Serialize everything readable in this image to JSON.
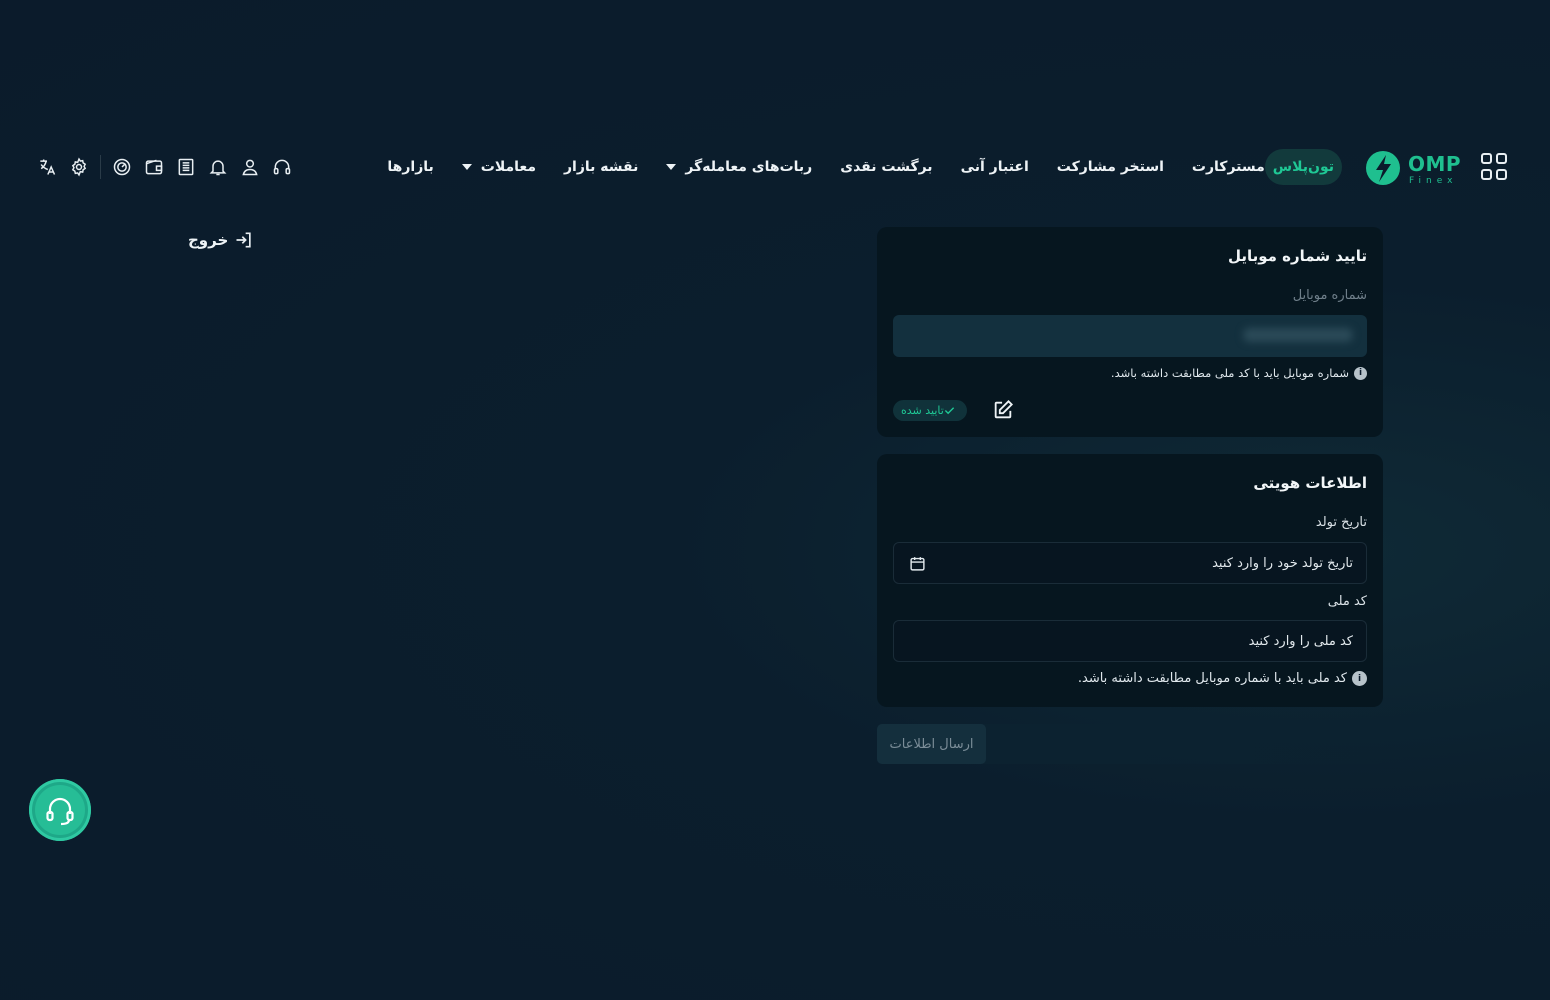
{
  "header": {
    "logo": {
      "word": "OMP",
      "sub": "Finex"
    },
    "nav": [
      {
        "label": "بازارها",
        "caret": false
      },
      {
        "label": "معاملات",
        "caret": true
      },
      {
        "label": "نقشه بازار",
        "caret": false
      },
      {
        "label": "ربات‌های معامله‌گر",
        "caret": true
      },
      {
        "label": "برگشت نقدی",
        "caret": false
      },
      {
        "label": "اعتبار آنی",
        "caret": false
      },
      {
        "label": "استخر مشارکت",
        "caret": false
      },
      {
        "label": "مسترکارت",
        "caret": false
      },
      {
        "label": "تون‌پلاس",
        "caret": false,
        "highlight": true
      }
    ],
    "toolbar_icons": [
      "headset-icon",
      "user-icon",
      "bell-icon",
      "orders-icon",
      "wallet-icon",
      "gauge-icon",
      "settings-icon",
      "language-icon"
    ]
  },
  "logout": {
    "label": "خروج"
  },
  "mobile_card": {
    "title": "تایید شماره موبایل",
    "field_label": "شماره موبایل",
    "hint": "شماره موبایل باید با کد ملی مطابقت داشته باشد.",
    "status": "تایید شده"
  },
  "identity_card": {
    "title": "اطلاعات هویتی",
    "birth_label": "تاریخ تولد",
    "birth_placeholder": "تاریخ تولد خود را وارد کنید",
    "national_label": "کد ملی",
    "national_placeholder": "کد ملی را وارد کنید",
    "hint": "کد ملی باید با شماره موبایل مطابقت داشته باشد."
  },
  "submit": {
    "label": "ارسال اطلاعات"
  },
  "colors": {
    "accent": "#1fc895",
    "background": "#0b1b2b",
    "card": "#06161f"
  }
}
